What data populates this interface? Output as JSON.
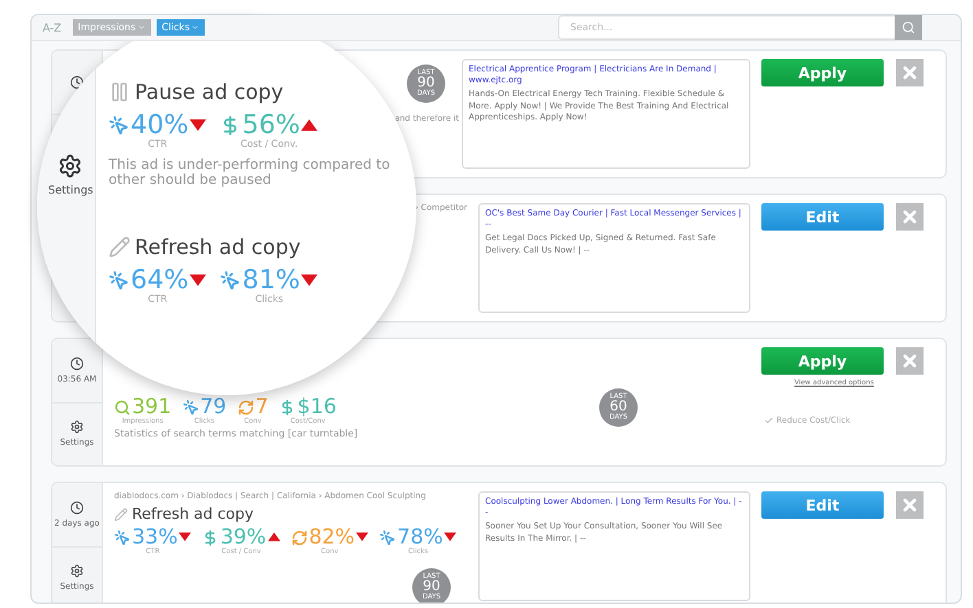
{
  "toolbar": {
    "sort_label": "A-Z",
    "filters": [
      {
        "label": "Impressions",
        "selected": false
      },
      {
        "label": "Clicks",
        "selected": true
      }
    ],
    "search": {
      "placeholder": "Search..."
    }
  },
  "cards": [
    {
      "fragment": "and therefore it",
      "badge": {
        "top": "LAST",
        "value": "90",
        "bottom": "DAYS"
      },
      "ad": {
        "headline": "Electrical Apprentice Program | Electricians Are In Demand | www.ejtc.org",
        "body": "Hands-On Electrical Energy Tech Training. Flexible Schedule & More. Apply Now! | We Provide The Best Training And Electrical Apprenticeships. Apply Now!"
      },
      "action": {
        "kind": "apply",
        "label": "Apply"
      }
    },
    {
      "breadcrumb": "› Competitor",
      "ad": {
        "headline": "OC's Best Same Day Courier | Fast Local Messenger Services | --",
        "body": "Get Legal Docs Picked Up, Signed & Returned. Fast Safe Delivery. Call Us Now! | --"
      },
      "action": {
        "kind": "edit",
        "label": "Edit"
      }
    },
    {
      "time": "03:56 AM",
      "settings": "Settings",
      "metrics": [
        {
          "kind": "impressions",
          "value": "391",
          "label": "Impressions",
          "color": "#8dc63f"
        },
        {
          "kind": "clicks",
          "value": "79",
          "label": "Clicks",
          "color": "#4aa8e8"
        },
        {
          "kind": "conversions",
          "value": "7",
          "label": "Conv",
          "color": "#f5a03a"
        },
        {
          "kind": "cost",
          "value": "$16",
          "label": "Cost/Conv",
          "color": "#4bbfb0"
        }
      ],
      "badge": {
        "top": "LAST",
        "value": "60",
        "bottom": "DAYS"
      },
      "description": "Statistics of search terms matching [car turntable]",
      "action": {
        "kind": "apply",
        "label": "Apply"
      },
      "link": "View advanced options",
      "note": "Reduce Cost/Click"
    },
    {
      "time": "2 days ago",
      "settings": "Settings",
      "breadcrumb": "diablodocs.com › Diablodocs | Search | California › Abdomen Cool Sculpting",
      "title": "Refresh ad copy",
      "kind": "refresh",
      "metrics": [
        {
          "kind": "clicks",
          "value": "33%",
          "label": "CTR",
          "color": "#4aa8e8",
          "rising": false
        },
        {
          "kind": "cost",
          "value": "39%",
          "label": "Cost / Conv",
          "color": "#4bbfb0",
          "rising": true
        },
        {
          "kind": "conversions",
          "value": "82%",
          "label": "Conv",
          "color": "#f5a03a",
          "rising": false
        },
        {
          "kind": "clicks",
          "value": "78%",
          "label": "Clicks",
          "color": "#4aa8e8",
          "rising": false
        }
      ],
      "badge": {
        "top": "LAST",
        "value": "90",
        "bottom": "DAYS"
      },
      "ad": {
        "headline": "Coolsculpting Lower Abdomen. | Long Term Results For You. | --",
        "body": "Sooner You Set Up Your Consultation, Sooner You Will See Results In The Mirror. | --"
      },
      "action": {
        "kind": "edit",
        "label": "Edit"
      }
    }
  ],
  "magnifier": {
    "settings": "Settings",
    "items": [
      {
        "title": "Pause ad copy",
        "kind": "pause",
        "metrics": [
          {
            "kind": "clicks",
            "value": "40%",
            "label": "CTR",
            "color": "#4aa8e8",
            "rising": false
          },
          {
            "kind": "cost",
            "value": "56%",
            "label": "Cost / Conv.",
            "color": "#4bbfb0",
            "rising": true
          }
        ],
        "description": "This ad is under-performing compared to other should be paused"
      },
      {
        "title": "Refresh ad copy",
        "kind": "refresh",
        "metrics": [
          {
            "kind": "clicks",
            "value": "64%",
            "label": "CTR",
            "color": "#4aa8e8",
            "rising": false
          },
          {
            "kind": "clicks",
            "value": "81%",
            "label": "Clicks",
            "color": "#4aa8e8",
            "rising": false
          }
        ]
      }
    ]
  }
}
